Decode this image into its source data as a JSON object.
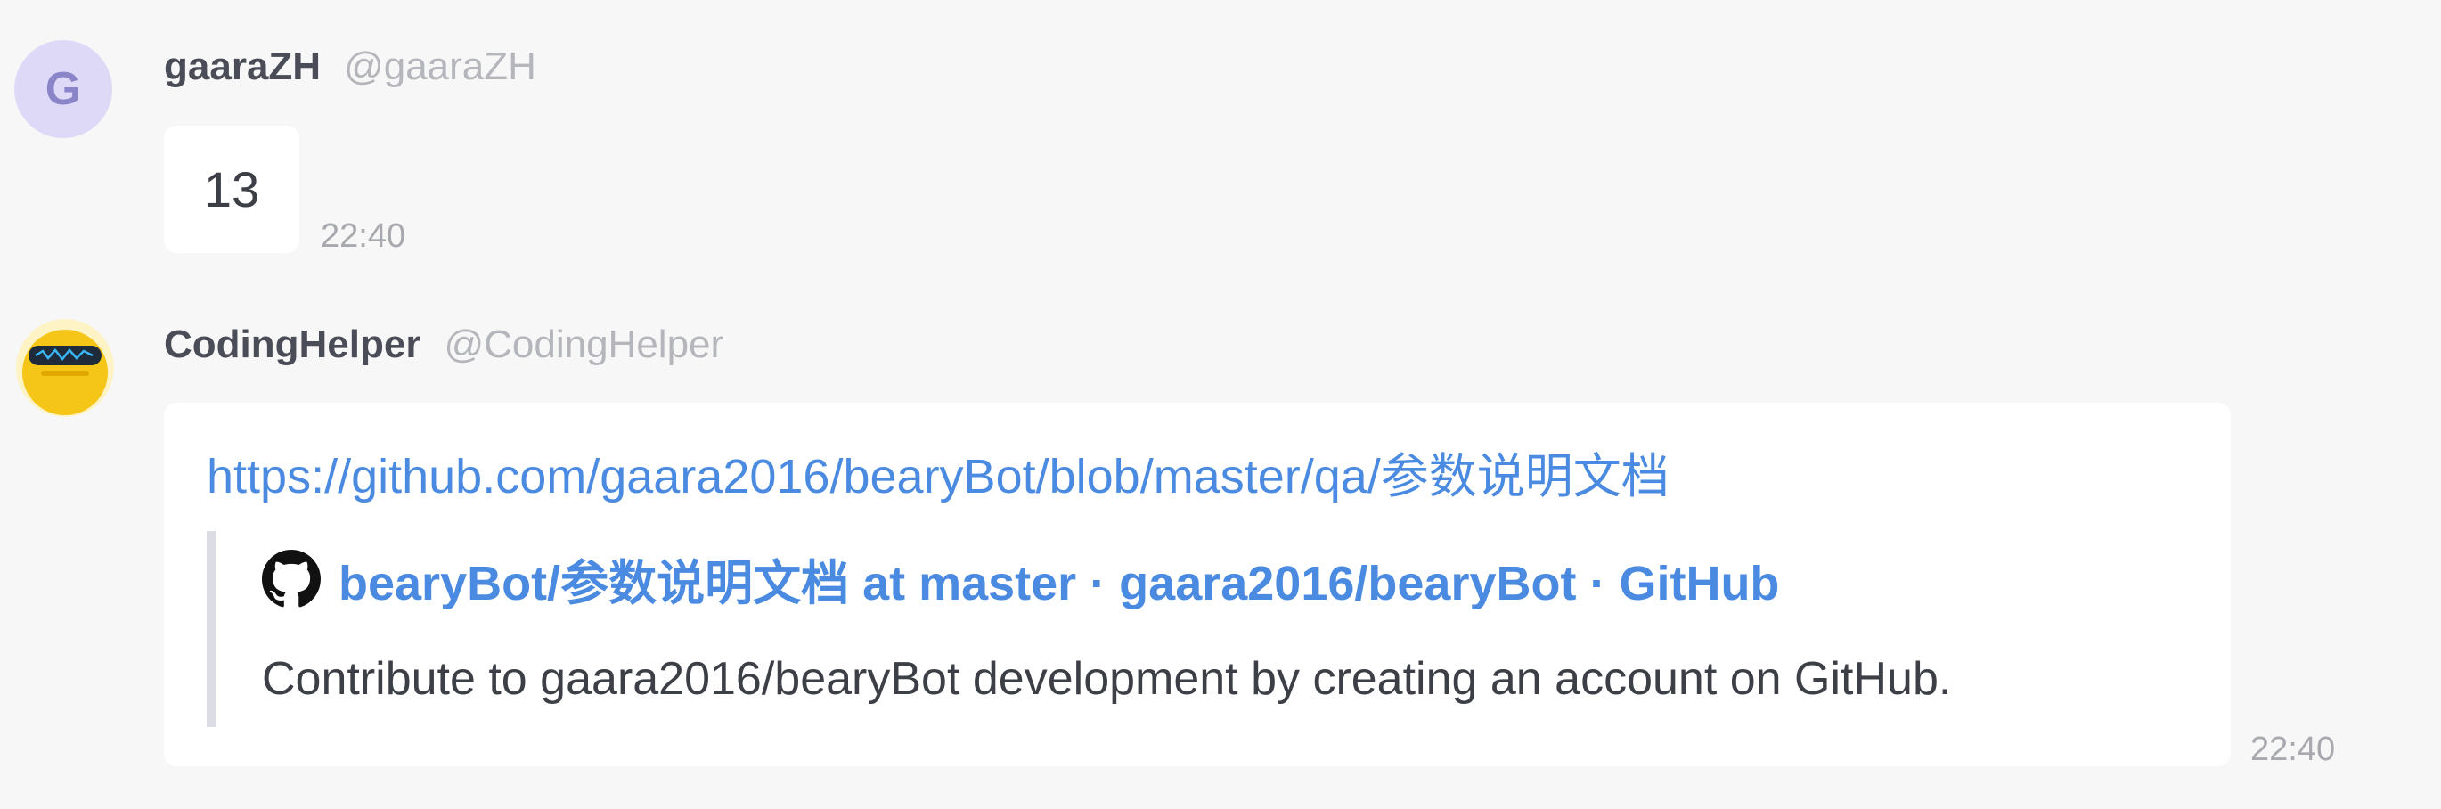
{
  "messages": [
    {
      "avatar_letter": "G",
      "user_name": "gaaraZH",
      "user_handle": "@gaaraZH",
      "text": "13",
      "time": "22:40"
    },
    {
      "user_name": "CodingHelper",
      "user_handle": "@CodingHelper",
      "link_url": "https://github.com/gaara2016/bearyBot/blob/master/qa/参数说明文档",
      "preview": {
        "icon": "github-icon",
        "title": "bearyBot/参数说明文档 at master · gaara2016/bearyBot · GitHub",
        "description": "Contribute to gaara2016/bearyBot development by creating an account on GitHub."
      },
      "time": "22:40"
    }
  ],
  "colors": {
    "background": "#f7f7f7",
    "link": "#4a8ae0",
    "username": "#4a4d57",
    "handle": "#b4b6bb",
    "avatar_letter_bg": "#ddd9f7",
    "bot_avatar": "#f5c518"
  }
}
